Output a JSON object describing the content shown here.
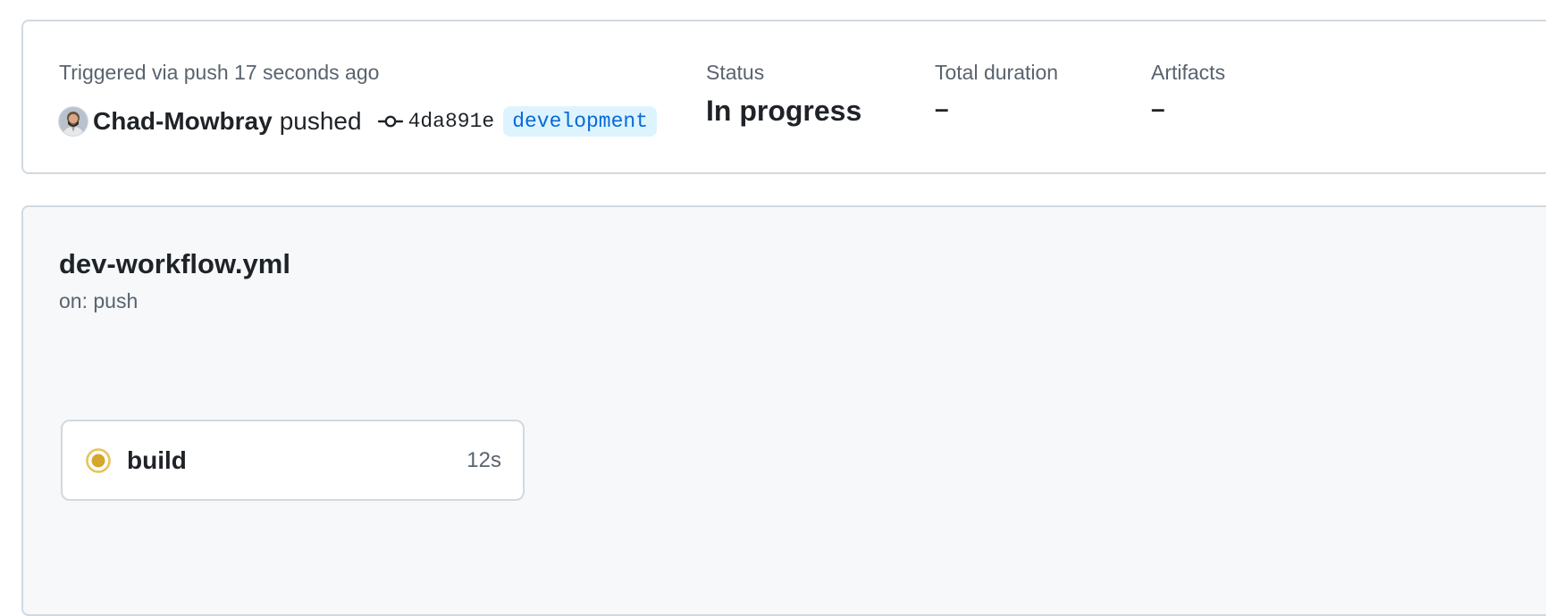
{
  "run_summary": {
    "trigger_text": "Triggered via push 17 seconds ago",
    "actor": "Chad-Mowbray",
    "action": "pushed",
    "commit_sha": "4da891e",
    "branch": "development",
    "status_label": "Status",
    "status_value": "In progress",
    "duration_label": "Total duration",
    "duration_value": "–",
    "artifacts_label": "Artifacts",
    "artifacts_value": "–",
    "icons": {
      "avatar": "user-avatar",
      "commit": "git-commit-icon"
    }
  },
  "workflow": {
    "file_name": "dev-workflow.yml",
    "trigger": "on: push",
    "jobs": [
      {
        "name": "build",
        "duration": "12s",
        "status": "in_progress",
        "status_icon": "in-progress-icon",
        "status_color": "#bf8700"
      }
    ]
  },
  "colors": {
    "branch_text": "#0969da",
    "branch_bg": "#ddf4ff",
    "border": "#d1d9e0",
    "muted_text": "#59636e",
    "panel_bg": "#f6f8fa"
  }
}
